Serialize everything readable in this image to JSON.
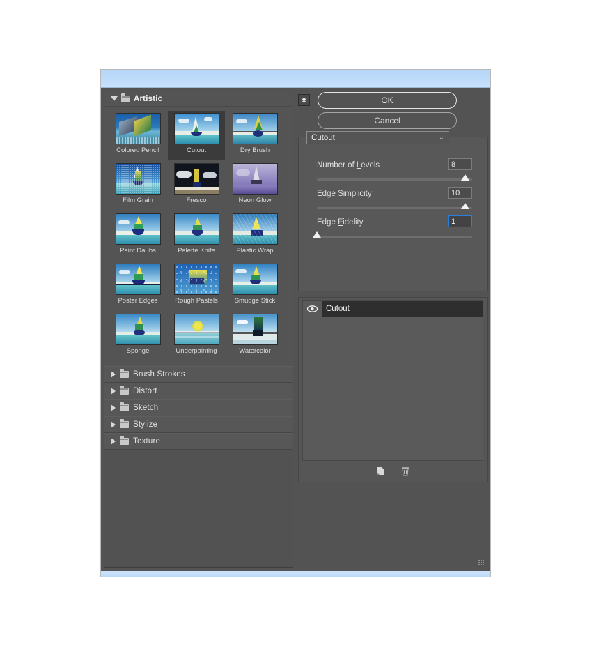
{
  "window": {
    "title": "",
    "collapse_icon": "double-chevron-up-icon",
    "resize_grip": "resize-grip-icon"
  },
  "buttons": {
    "ok": "OK",
    "cancel": "Cancel"
  },
  "filter_select": {
    "value": "Cutout",
    "chevron": "chevron-down-icon"
  },
  "categories": [
    {
      "name": "Artistic",
      "expanded": true,
      "filters": [
        {
          "label": "Colored Pencil",
          "selected": false,
          "style": "pencil"
        },
        {
          "label": "Cutout",
          "selected": true,
          "style": "cutout"
        },
        {
          "label": "Dry Brush",
          "selected": false,
          "style": "drybrush"
        },
        {
          "label": "Film Grain",
          "selected": false,
          "style": "filmgrain"
        },
        {
          "label": "Fresco",
          "selected": false,
          "style": "fresco"
        },
        {
          "label": "Neon Glow",
          "selected": false,
          "style": "neon"
        },
        {
          "label": "Paint Daubs",
          "selected": false,
          "style": "daubs"
        },
        {
          "label": "Palette Knife",
          "selected": false,
          "style": "knife"
        },
        {
          "label": "Plastic Wrap",
          "selected": false,
          "style": "plastic"
        },
        {
          "label": "Poster Edges",
          "selected": false,
          "style": "poster"
        },
        {
          "label": "Rough Pastels",
          "selected": false,
          "style": "pastels"
        },
        {
          "label": "Smudge Stick",
          "selected": false,
          "style": "smudge"
        },
        {
          "label": "Sponge",
          "selected": false,
          "style": "sponge"
        },
        {
          "label": "Underpainting",
          "selected": false,
          "style": "under"
        },
        {
          "label": "Watercolor",
          "selected": false,
          "style": "water"
        }
      ]
    },
    {
      "name": "Brush Strokes",
      "expanded": false,
      "filters": []
    },
    {
      "name": "Distort",
      "expanded": false,
      "filters": []
    },
    {
      "name": "Sketch",
      "expanded": false,
      "filters": []
    },
    {
      "name": "Stylize",
      "expanded": false,
      "filters": []
    },
    {
      "name": "Texture",
      "expanded": false,
      "filters": []
    }
  ],
  "parameters": [
    {
      "label_pre": "Number of ",
      "label_accel": "L",
      "label_post": "evels",
      "value": "8",
      "min": 2,
      "max": 8,
      "percent": 96,
      "focused": false
    },
    {
      "label_pre": "Edge ",
      "label_accel": "S",
      "label_post": "implicity",
      "value": "10",
      "min": 0,
      "max": 10,
      "percent": 96,
      "focused": false
    },
    {
      "label_pre": "Edge ",
      "label_accel": "F",
      "label_post": "idelity",
      "value": "1",
      "min": 1,
      "max": 3,
      "percent": 1,
      "focused": true
    }
  ],
  "effect_layers": [
    {
      "name": "Cutout",
      "visible": true,
      "eye_icon": "eye-icon"
    }
  ],
  "layer_tools": [
    {
      "name": "new-effect-layer-icon",
      "title": "New effect layer"
    },
    {
      "name": "delete-effect-layer-icon",
      "title": "Delete effect layer"
    }
  ],
  "colors": {
    "panel_bg": "#535353",
    "titlebar": "#bcdafa",
    "accent_focus": "#2a7fdb",
    "selected_cell": "#3b3b3b",
    "layer_row": "#2e2e2e"
  }
}
